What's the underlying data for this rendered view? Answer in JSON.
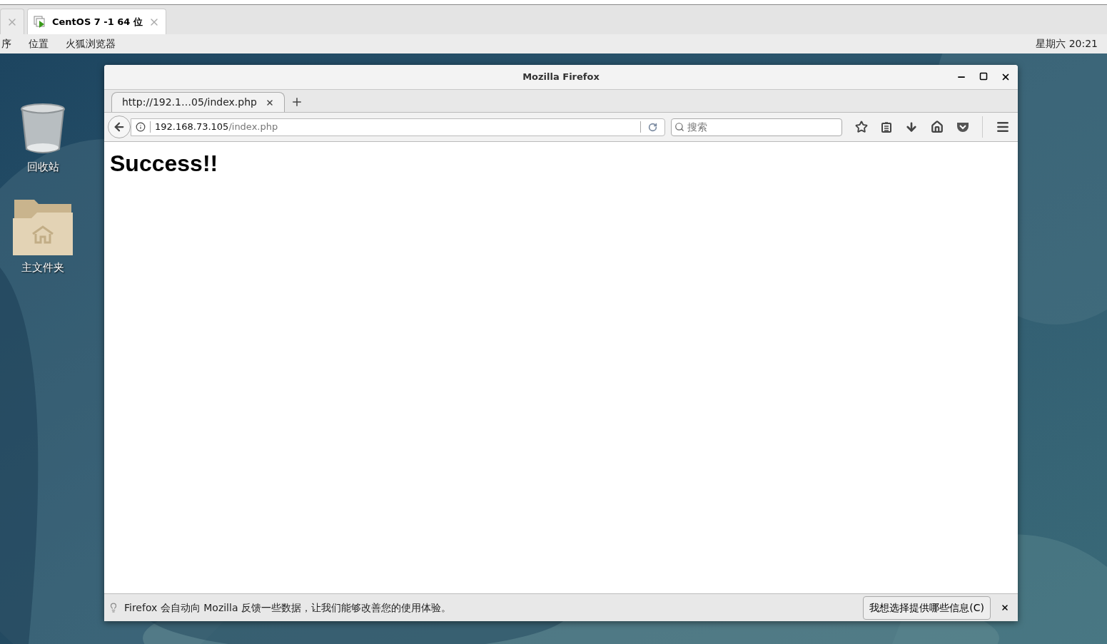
{
  "vm_tabs": [
    {
      "selected": false
    },
    {
      "label": "CentOS 7 -1 64 位",
      "selected": true
    }
  ],
  "top_bar": {
    "menus": [
      "序",
      "位置",
      "火狐浏览器"
    ],
    "clock": "星期六 20:21"
  },
  "desktop_icons": [
    {
      "label": "回收站",
      "kind": "trash"
    },
    {
      "label": "主文件夹",
      "kind": "home"
    }
  ],
  "firefox": {
    "title": "Mozilla Firefox",
    "tabs": [
      {
        "label": "http://192.1…05/index.php",
        "selected": true
      }
    ],
    "url": {
      "host": "192.168.73.105",
      "path": "/index.php"
    },
    "search": {
      "placeholder": "搜索"
    },
    "page": {
      "heading": "Success!!"
    },
    "notification": {
      "text": "Firefox 会自动向 Mozilla 反馈一些数据，让我们能够改善您的使用体验。",
      "button": "我想选择提供哪些信息(C)"
    }
  }
}
